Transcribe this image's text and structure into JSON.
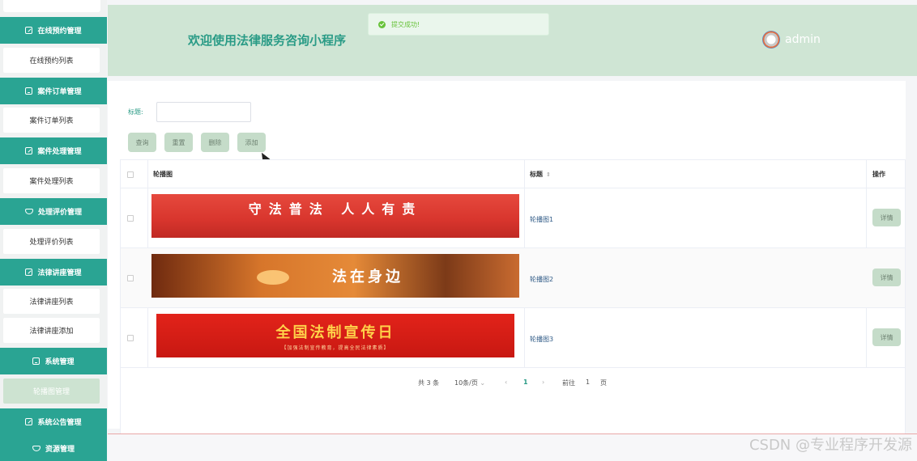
{
  "sidebar": {
    "groups": [
      {
        "label": "在线预约管理",
        "icon": "pen-icon"
      },
      {
        "label": "案件订单管理",
        "icon": "doc-icon"
      },
      {
        "label": "案件处理管理",
        "icon": "pen-icon"
      },
      {
        "label": "处理评价管理",
        "icon": "gem-icon"
      },
      {
        "label": "法律讲座管理",
        "icon": "pen-icon"
      },
      {
        "label": "系统管理",
        "icon": "doc-icon"
      },
      {
        "label": "系统公告管理",
        "icon": "pen-icon"
      },
      {
        "label": "资源管理",
        "icon": "gem-icon"
      }
    ],
    "items": [
      {
        "label": "在线预约列表"
      },
      {
        "label": "案件订单列表"
      },
      {
        "label": "案件处理列表"
      },
      {
        "label": "处理评价列表"
      },
      {
        "label": "法律讲座列表"
      },
      {
        "label": "法律讲座添加"
      },
      {
        "label": "轮播图管理",
        "active": true
      }
    ]
  },
  "header": {
    "title": "欢迎使用法律服务咨询小程序",
    "username": "admin"
  },
  "toast": {
    "message": "提交成功!"
  },
  "search": {
    "label": "标题:",
    "placeholder": "",
    "value": ""
  },
  "toolbar": {
    "query": "查询",
    "reset": "重置",
    "delete": "删除",
    "add": "添加"
  },
  "table": {
    "columns": {
      "image": "轮播图",
      "title": "标题",
      "actions": "操作"
    },
    "rows": [
      {
        "banner_text": "守法普法 人人有责",
        "title": "轮播图1",
        "action": "详情"
      },
      {
        "banner_text": "法在身边",
        "title": "轮播图2",
        "action": "详情"
      },
      {
        "banner_text": "全国法制宣传日",
        "banner_subtext": "【加强法制宣传教育，提高全民法律素质】",
        "title": "轮播图3",
        "action": "详情"
      }
    ]
  },
  "pagination": {
    "total": "共 3 条",
    "page_size": "10条/页",
    "current": "1",
    "goto_prefix": "前往",
    "goto_value": "1",
    "goto_suffix": "页"
  },
  "watermark": "CSDN @专业程序开发源",
  "colors": {
    "accent": "#2aa493",
    "header_bg": "#cfe5d4",
    "button_bg": "#c5dcc9"
  }
}
